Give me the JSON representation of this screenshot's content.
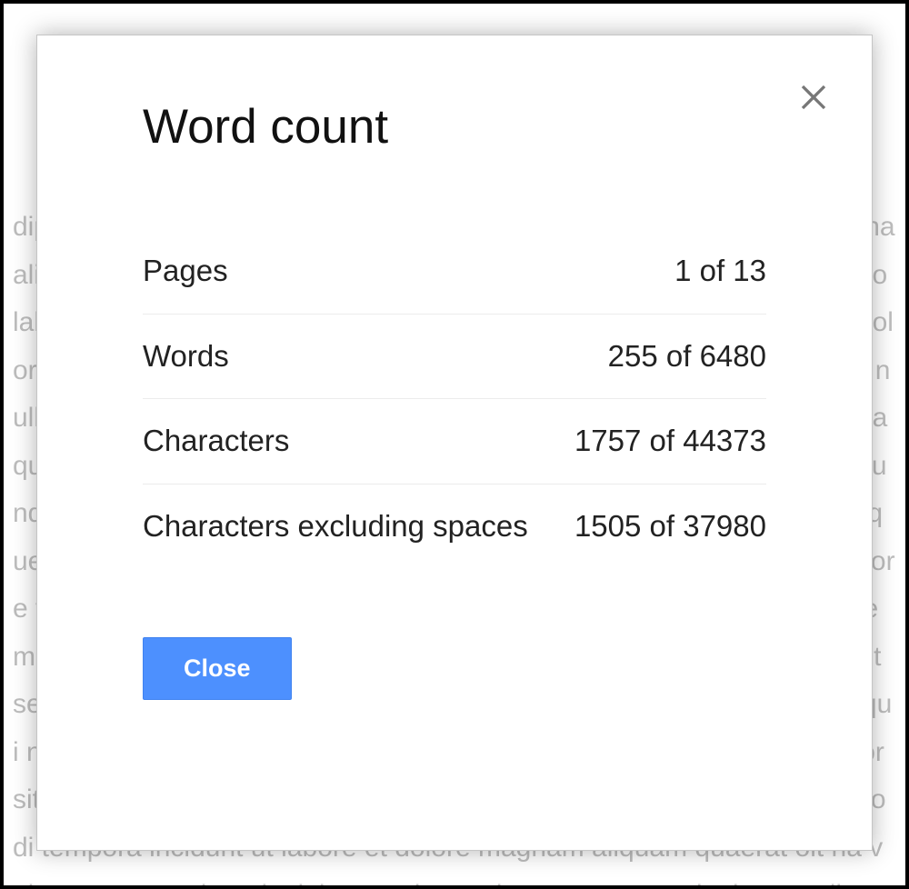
{
  "dialog": {
    "title": "Word count",
    "close_button_label": "Close",
    "stats": {
      "pages": {
        "label": "Pages",
        "value": "1 of 13"
      },
      "words": {
        "label": "Words",
        "value": "255 of 6480"
      },
      "characters": {
        "label": "Characters",
        "value": "1757 of 44373"
      },
      "characters_no_spaces": {
        "label": "Characters excluding spaces",
        "value": "1505 of 37980"
      }
    }
  },
  "background_text": "dipiscing elit sed do eiusmod tempor incididunt ut labore et dolore magna aliqua ut enim ad pis sa. minim veniam quis nostrud exercitation ullamco laboris nisi ut aliquip ex ea commodo ha ha consequat duis aute irure dolor in reprehenderit in voluptate velit esse cillum dolore eu am t m fugiat nulla pariatur excepteur sint occaecat cupidatat non proident sunt in culpa qui pis ed officia deserunt mollit anim id est laborum sed ut perspiciatis unde omnis iste natus ree s, s error sit voluptatem accusantium doloremque laudantium totam rem aperiam eaque ipsa s e t n quae ab illo inventore veritatis et quasi architecto beatae vitae dicta sunt explicabo us Do nemo enim ipsam voluptatem quia voluptas sit aspernatur aut odit aut fugit sed quia et consequuntur magni dolores eos qui ratione voluptatem sequi nesciunt neque porro quisquam nu co est qui dolorem ipsum quia dolor sit amet consectetur adipisci velit sed quia non Se ne numquam eius modi tempora incidunt ut labore et dolore magnam aliquam quaerat oit na voluptatem ut enim ad minima veniam quis nostrum exercitationem ullam corporis s o sar suscipit laboriosam nisi ut aliquid ex ea commodi consequatur quis autem vel eum iure rtt erc reprehenderit qui in ea voluptate velit esse quam nihil molestiae consequatur vel illum er ivamus a mi. Morbi neque. Aliquam erat volutpat. Integer ultrices lobortis eros."
}
